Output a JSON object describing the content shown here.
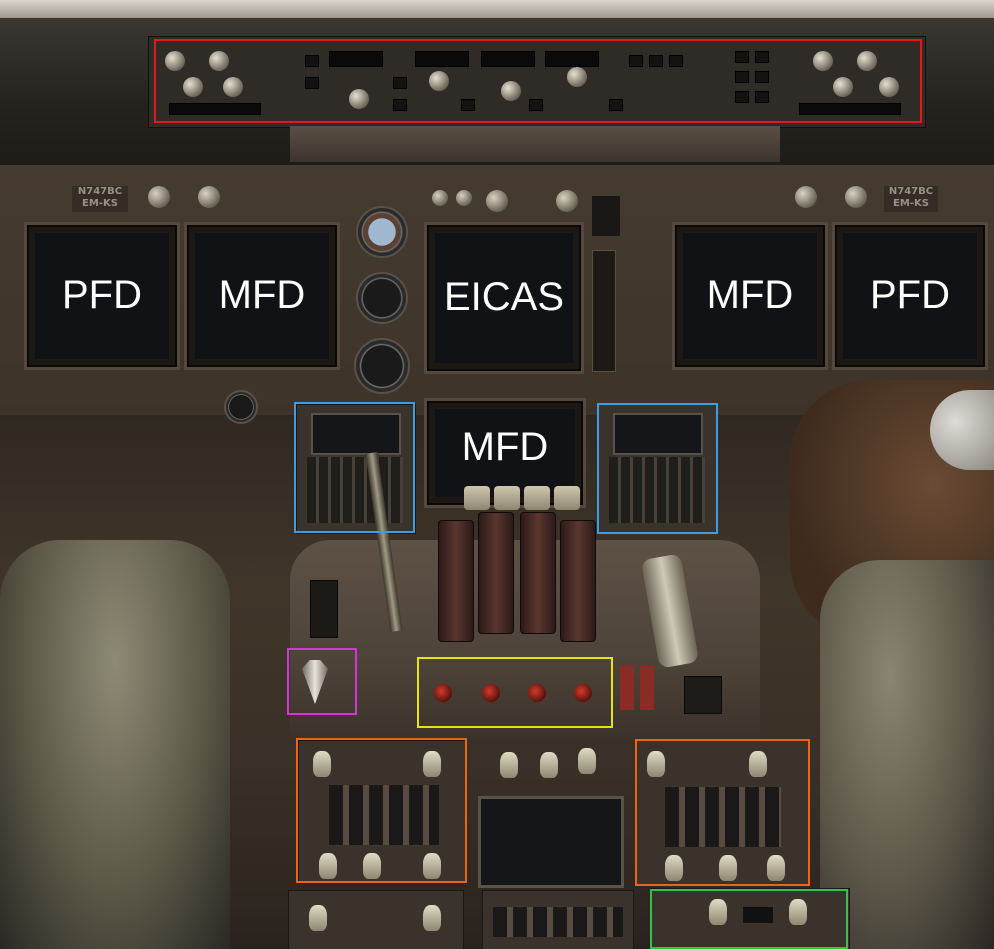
{
  "labels": {
    "pfd_left": "PFD",
    "mfd_left": "MFD",
    "eicas": "EICAS",
    "mfd_right": "MFD",
    "pfd_right": "PFD",
    "mfd_lower": "MFD"
  },
  "plaques": {
    "left": "N747BC\nEM-KS",
    "right": "N747BC\nEM-KS"
  },
  "highlight_colors": {
    "mcp": "#e01b1b",
    "cdu": "#3a9ee6",
    "fire_handles": "#e6e21c",
    "flap_lever": "#d235d8",
    "radio_panels": "#e8661c",
    "transponder": "#35c24a"
  }
}
